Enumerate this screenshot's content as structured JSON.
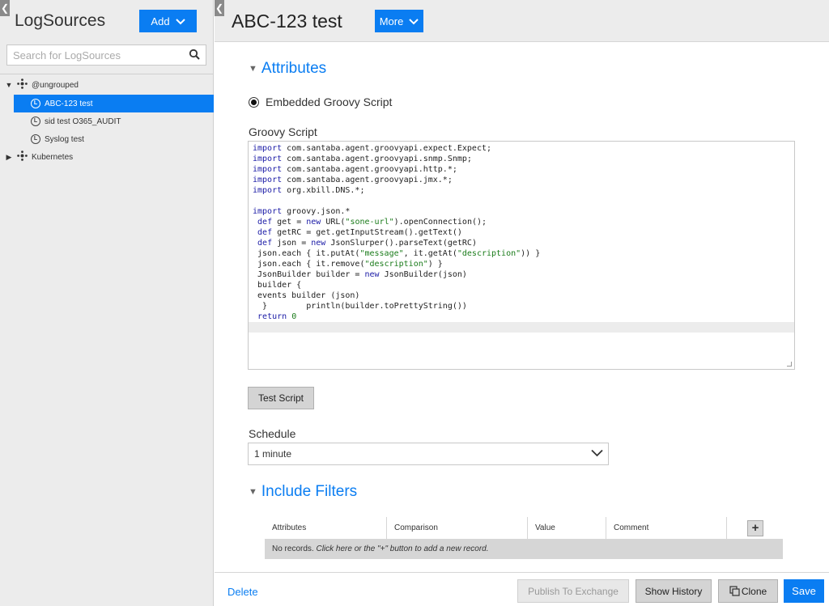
{
  "sidebar": {
    "collapse_glyph": "❮",
    "title": "LogSources",
    "add_label": "Add",
    "search_placeholder": "Search for LogSources",
    "tree": {
      "group1": {
        "label": "@ungrouped",
        "expanded": true
      },
      "items": [
        {
          "label": "ABC-123 test",
          "selected": true
        },
        {
          "label": "sid test O365_AUDIT",
          "selected": false
        },
        {
          "label": "Syslog test",
          "selected": false
        }
      ],
      "group2": {
        "label": "Kubernetes",
        "expanded": false
      }
    }
  },
  "header": {
    "title": "ABC-123 test",
    "more_label": "More"
  },
  "attributes": {
    "section_title": "Attributes",
    "radio_label": "Embedded Groovy Script",
    "script_label": "Groovy Script",
    "script_lines": [
      "import com.santaba.agent.groovyapi.expect.Expect;",
      "import com.santaba.agent.groovyapi.snmp.Snmp;",
      "import com.santaba.agent.groovyapi.http.*;",
      "import com.santaba.agent.groovyapi.jmx.*;",
      "import org.xbill.DNS.*;",
      "",
      "import groovy.json.*",
      " def get = new URL(\"sone-url\").openConnection();",
      " def getRC = get.getInputStream().getText()",
      " def json = new JsonSlurper().parseText(getRC)",
      " json.each { it.putAt(\"message\", it.getAt(\"description\")) }",
      " json.each { it.remove(\"description\") }",
      " JsonBuilder builder = new JsonBuilder(json)",
      " builder {",
      " events builder (json)",
      "  }        println(builder.toPrettyString())",
      " return 0",
      ""
    ],
    "test_label": "Test Script",
    "schedule_label": "Schedule",
    "schedule_value": "1 minute"
  },
  "filters": {
    "section_title": "Include Filters",
    "columns": [
      "Attributes",
      "Comparison",
      "Value",
      "Comment"
    ],
    "add_glyph": "+",
    "empty_prefix": "No records. ",
    "empty_link": "Click here or the \"+\" button to add a new record."
  },
  "footer": {
    "delete_label": "Delete",
    "publish_label": "Publish To Exchange",
    "history_label": "Show History",
    "clone_label": "Clone",
    "save_label": "Save"
  },
  "colors": {
    "accent": "#0a7df2",
    "sidebar_bg": "#ececec",
    "keyword": "#1a1aa6",
    "string": "#1a7b1a"
  }
}
